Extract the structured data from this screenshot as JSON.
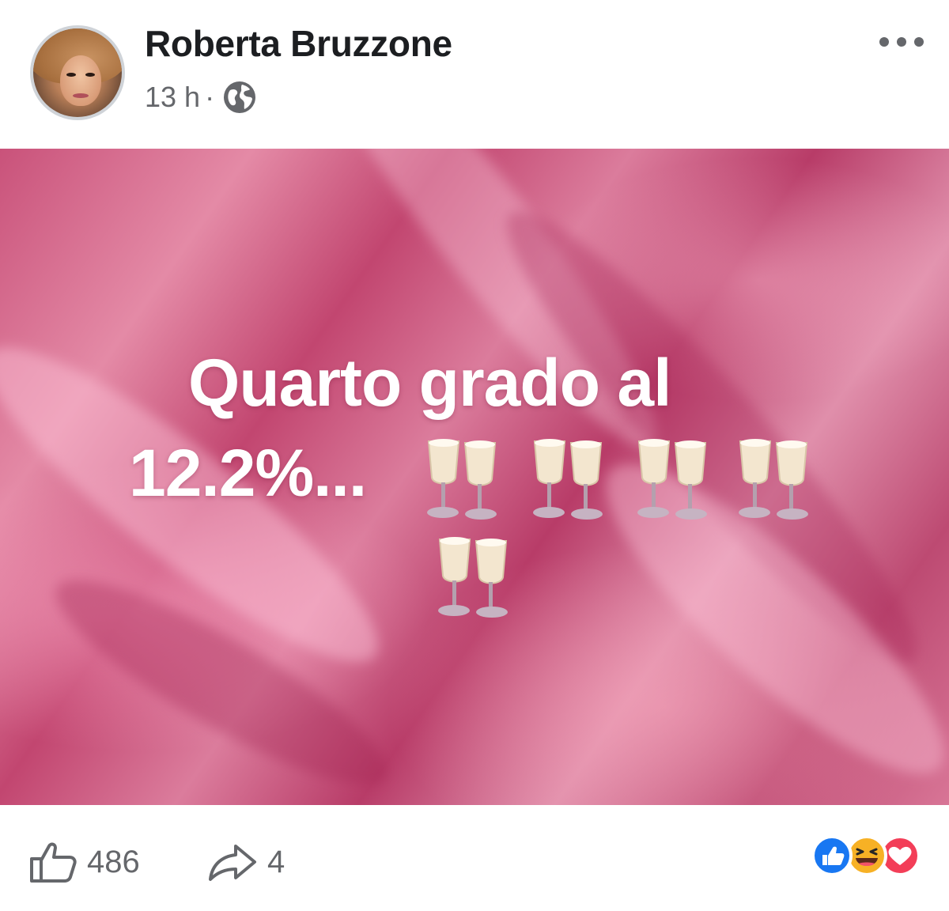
{
  "post": {
    "author": "Roberta Bruzzone",
    "time": "13 h",
    "separator": "·",
    "audience_icon": "globe-icon",
    "more_icon": "more-options-icon"
  },
  "media": {
    "text_line1": "Quarto grado al",
    "text_line2": "12.2%...",
    "emoji": "clinking-glasses",
    "emoji_count": 5,
    "background_colors": [
      "#c9527a",
      "#e48aa6",
      "#b83c68"
    ]
  },
  "footer": {
    "like_icon": "thumbs-up-outline-icon",
    "like_count": "486",
    "share_icon": "share-arrow-icon",
    "share_count": "4",
    "reaction_icons": [
      "like-reaction-icon",
      "haha-reaction-icon",
      "love-reaction-icon"
    ]
  },
  "colors": {
    "name_text": "#1c1e21",
    "meta_text": "#65676b",
    "like_blue": "#1877f2",
    "love_red": "#f33e58",
    "haha_yellow": "#f7b125"
  }
}
